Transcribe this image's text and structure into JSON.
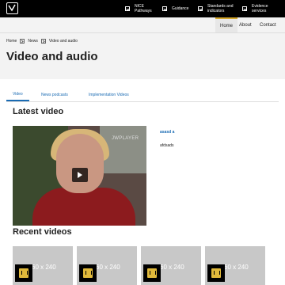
{
  "header": {
    "logo_text": "",
    "nav": [
      {
        "label": "NICE Pathways"
      },
      {
        "label": "Guidance"
      },
      {
        "label": "Standards and indicators"
      },
      {
        "label": "Evidence services"
      }
    ]
  },
  "secnav": {
    "items": [
      {
        "label": "Home",
        "active": true
      },
      {
        "label": "About",
        "active": false
      },
      {
        "label": "Contact",
        "active": false
      }
    ]
  },
  "breadcrumb": [
    "Home",
    "News",
    "Video and audio"
  ],
  "page_title": "Video and audio",
  "tabs": [
    {
      "label": "Video",
      "active": true
    },
    {
      "label": "News podcasts",
      "active": false
    },
    {
      "label": "Implementation Videos",
      "active": false
    }
  ],
  "latest": {
    "title": "Latest video",
    "watermark": "JWPLAYER",
    "link": "asasd a",
    "description": "afdsads"
  },
  "recent": {
    "title": "Recent videos",
    "thumb_label": "60 x 240",
    "count": 4
  },
  "colors": {
    "accent": "#1a6bb3",
    "active_tab_border": "#d4a72c",
    "topbar": "#000000"
  }
}
